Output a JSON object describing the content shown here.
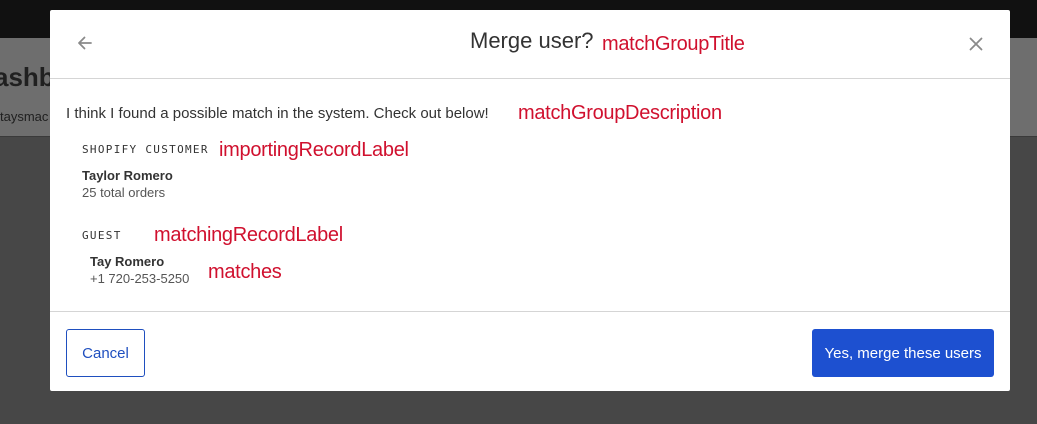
{
  "background": {
    "page_title_fragment": "ashb",
    "page_subtitle_fragment": "taysmac"
  },
  "modal": {
    "title": "Merge user?",
    "back_icon": "arrow-left-icon",
    "close_icon": "close-icon",
    "description": "I think I found a possible match in the system. Check out below!",
    "importing_record": {
      "label": "SHOPIFY CUSTOMER",
      "name": "Taylor Romero",
      "detail": "25 total orders"
    },
    "matching_record": {
      "label": "GUEST",
      "name": "Tay Romero",
      "detail": "+1 720-253-5250"
    },
    "cancel_label": "Cancel",
    "confirm_label": "Yes, merge these users"
  },
  "annotations": {
    "title": "matchGroupTitle",
    "description": "matchGroupDescription",
    "importing": "importingRecordLabel",
    "matching": "matchingRecordLabel",
    "matches": "matches"
  },
  "colors": {
    "annotation": "#d0102e",
    "primary": "#1d50d0",
    "overlay": "#474747"
  }
}
